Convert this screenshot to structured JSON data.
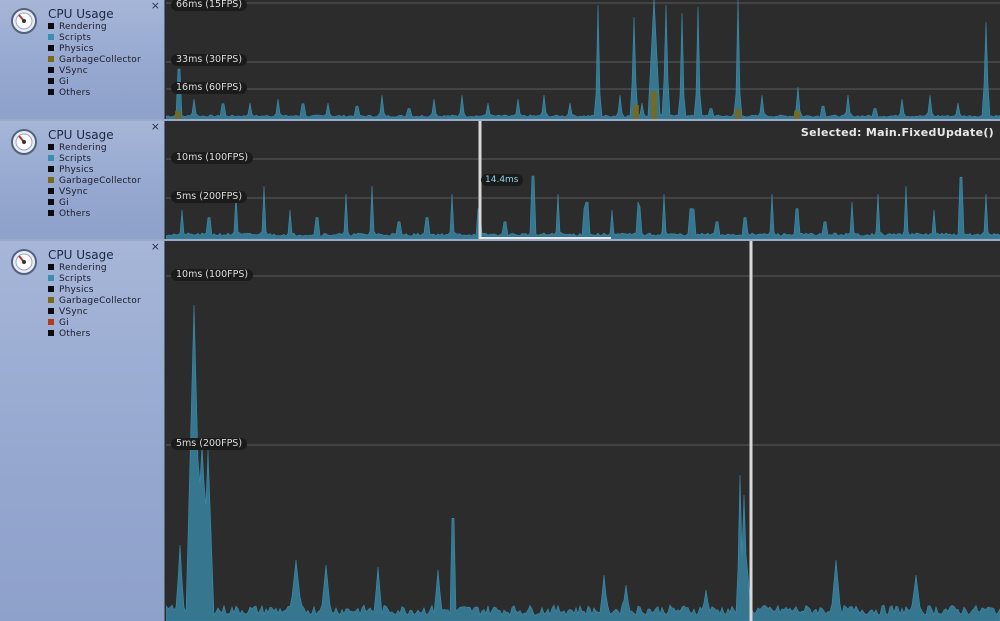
{
  "panels": [
    {
      "title": "CPU Usage",
      "close_glyph": "×",
      "legend": [
        {
          "label": "Rendering",
          "color": "#0c0c0c"
        },
        {
          "label": "Scripts",
          "color": "#3a8fb0"
        },
        {
          "label": "Physics",
          "color": "#0c0c0c"
        },
        {
          "label": "GarbageCollector",
          "color": "#7a6a16"
        },
        {
          "label": "VSync",
          "color": "#0c0c0c"
        },
        {
          "label": "Gi",
          "color": "#0c0c0c"
        },
        {
          "label": "Others",
          "color": "#0c0c0c"
        }
      ],
      "gridlines": [
        "66ms (15FPS)",
        "33ms (30FPS)",
        "16ms (60FPS)"
      ]
    },
    {
      "title": "CPU Usage",
      "close_glyph": "×",
      "legend": [
        {
          "label": "Rendering",
          "color": "#0c0c0c"
        },
        {
          "label": "Scripts",
          "color": "#3a8fb0"
        },
        {
          "label": "Physics",
          "color": "#0c0c0c"
        },
        {
          "label": "GarbageCollector",
          "color": "#7a6a16"
        },
        {
          "label": "VSync",
          "color": "#0c0c0c"
        },
        {
          "label": "Gi",
          "color": "#0c0c0c"
        },
        {
          "label": "Others",
          "color": "#0c0c0c"
        }
      ],
      "gridlines": [
        "10ms (100FPS)",
        "5ms (200FPS)"
      ],
      "selected_label": "Selected: Main.FixedUpdate()",
      "frame_value": "14.4ms"
    },
    {
      "title": "CPU Usage",
      "close_glyph": "×",
      "legend": [
        {
          "label": "Rendering",
          "color": "#0c0c0c"
        },
        {
          "label": "Scripts",
          "color": "#3a8fb0"
        },
        {
          "label": "Physics",
          "color": "#0c0c0c"
        },
        {
          "label": "GarbageCollector",
          "color": "#7a6a16"
        },
        {
          "label": "VSync",
          "color": "#0c0c0c"
        },
        {
          "label": "Gi",
          "color": "#b03a1e"
        },
        {
          "label": "Others",
          "color": "#0c0c0c"
        }
      ],
      "gridlines": [
        "10ms (100FPS)",
        "5ms (200FPS)"
      ]
    }
  ],
  "colors": {
    "scripts": "#3a8fb0",
    "garbage": "#7a6a16",
    "grid": "#5a5a5a",
    "selection": "#d8d8d8"
  }
}
